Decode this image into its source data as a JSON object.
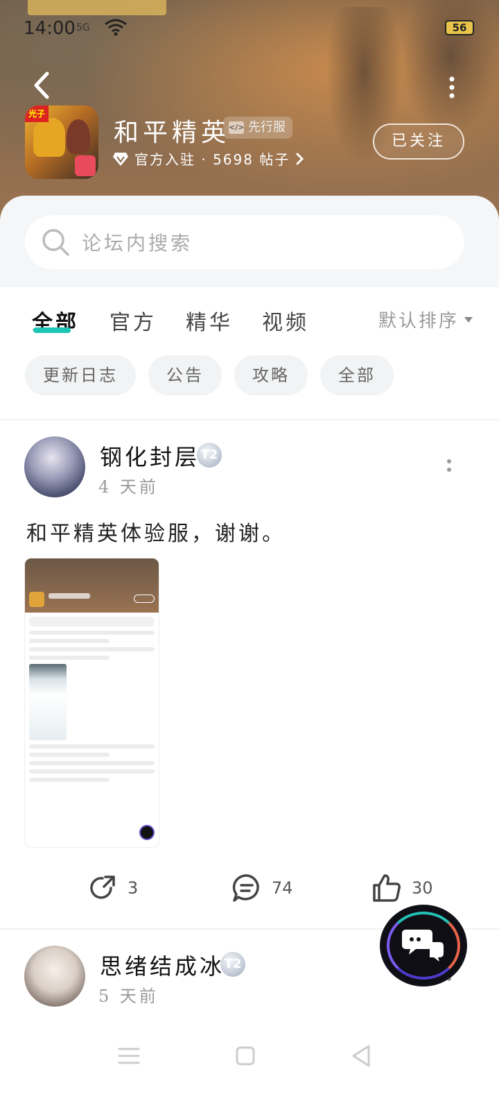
{
  "status_bar": {
    "time": "14:00",
    "signal": "5G",
    "battery": "56"
  },
  "header": {
    "forum_title": "和平精英",
    "server_badge": "先行服",
    "badge_icon_text": "</>",
    "meta": "官方入驻 · 5698 帖子",
    "follow_label": "已关注",
    "app_icon_tag": "光子"
  },
  "search": {
    "placeholder": "论坛内搜索"
  },
  "tabs": {
    "items": [
      {
        "label": "全部"
      },
      {
        "label": "官方"
      },
      {
        "label": "精华"
      },
      {
        "label": "视频"
      }
    ],
    "sort_label": "默认排序"
  },
  "chips": [
    {
      "label": "更新日志"
    },
    {
      "label": "公告"
    },
    {
      "label": "攻略"
    },
    {
      "label": "全部"
    }
  ],
  "posts": [
    {
      "username": "钢化封层",
      "level": "T2",
      "time": "4 天前",
      "body": "和平精英体验服，谢谢。",
      "shares": "3",
      "comments": "74",
      "likes": "30"
    },
    {
      "username": "思绪结成冰",
      "level": "T2",
      "time": "5 天前"
    }
  ],
  "colors": {
    "accent": "#1cc5b6",
    "header_bg": "#8a6a4c"
  },
  "icons": {
    "back": "chevron-left-icon",
    "more": "more-vertical-icon",
    "search": "search-icon",
    "share": "share-icon",
    "comment": "comment-icon",
    "like": "thumbs-up-icon",
    "fab": "chat-icon"
  }
}
